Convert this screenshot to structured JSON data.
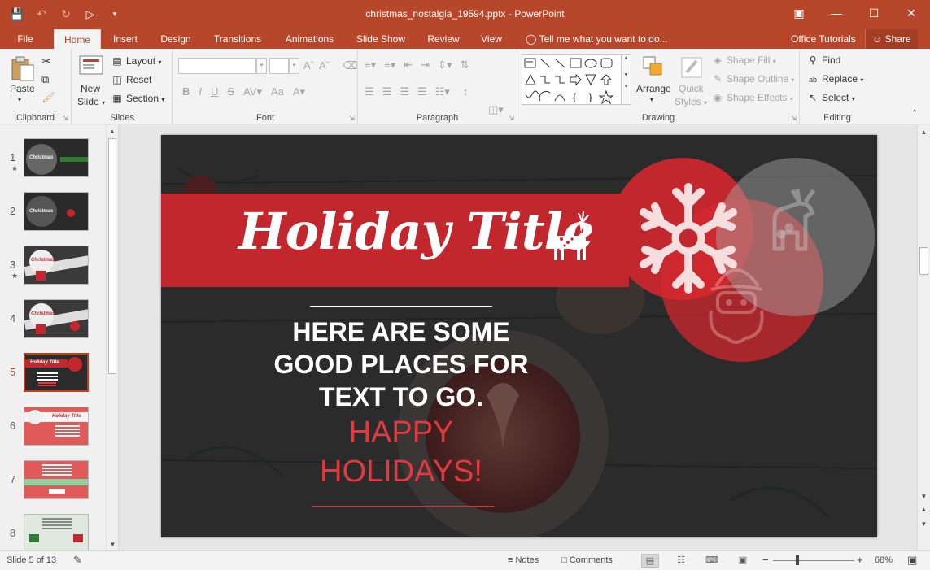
{
  "window": {
    "title": "christmas_nostalgia_19594.pptx - PowerPoint",
    "accent": "#b7472a"
  },
  "qat": {
    "icons": [
      "save-icon",
      "undo-icon",
      "redo-icon",
      "start-from-beginning-icon",
      "customize-qat-icon"
    ]
  },
  "tabs": {
    "file": "File",
    "home": "Home",
    "insert": "Insert",
    "design": "Design",
    "transitions": "Transitions",
    "animations": "Animations",
    "slideshow": "Slide Show",
    "review": "Review",
    "view": "View",
    "tellme": "Tell me what you want to do...",
    "office_tutorials": "Office Tutorials",
    "share": "Share"
  },
  "ribbon": {
    "clipboard": {
      "label": "Clipboard",
      "paste": "Paste"
    },
    "slides": {
      "label": "Slides",
      "new_slide_1": "New",
      "new_slide_2": "Slide",
      "layout": "Layout",
      "reset": "Reset",
      "section": "Section"
    },
    "font": {
      "label": "Font",
      "bold": "B",
      "italic": "I",
      "underline": "U",
      "strike": "S",
      "aa": "Aa"
    },
    "paragraph": {
      "label": "Paragraph"
    },
    "drawing": {
      "label": "Drawing",
      "arrange": "Arrange",
      "quick_styles_1": "Quick",
      "quick_styles_2": "Styles",
      "shape_fill": "Shape Fill",
      "shape_outline": "Shape Outline",
      "shape_effects": "Shape Effects"
    },
    "editing": {
      "label": "Editing",
      "find": "Find",
      "replace": "Replace",
      "select": "Select"
    }
  },
  "thumbnails": [
    {
      "num": "1",
      "star": true,
      "title": "Christmas"
    },
    {
      "num": "2",
      "star": false,
      "title": "Christmas"
    },
    {
      "num": "3",
      "star": true,
      "title": "Christmas"
    },
    {
      "num": "4",
      "star": false,
      "title": "Christmas"
    },
    {
      "num": "5",
      "star": false,
      "title": "Holiday Title",
      "selected": true
    },
    {
      "num": "6",
      "star": false,
      "title": "Holiday Title"
    },
    {
      "num": "7",
      "star": false,
      "title": ""
    },
    {
      "num": "8",
      "star": false,
      "title": ""
    }
  ],
  "slide": {
    "title": "Holiday Title",
    "body_line1": "HERE ARE SOME",
    "body_line2": "GOOD PLACES FOR",
    "body_line3": "TEXT TO GO.",
    "happy_line1": "HAPPY",
    "happy_line2": "HOLIDAYS!",
    "colors": {
      "banner": "#c1272d",
      "happy": "#e0393e",
      "background": "#2b2b2b"
    }
  },
  "status": {
    "slide_of": "Slide 5 of 13",
    "notes": "Notes",
    "comments": "Comments",
    "zoom": "68%",
    "minus": "−",
    "plus": "+"
  }
}
